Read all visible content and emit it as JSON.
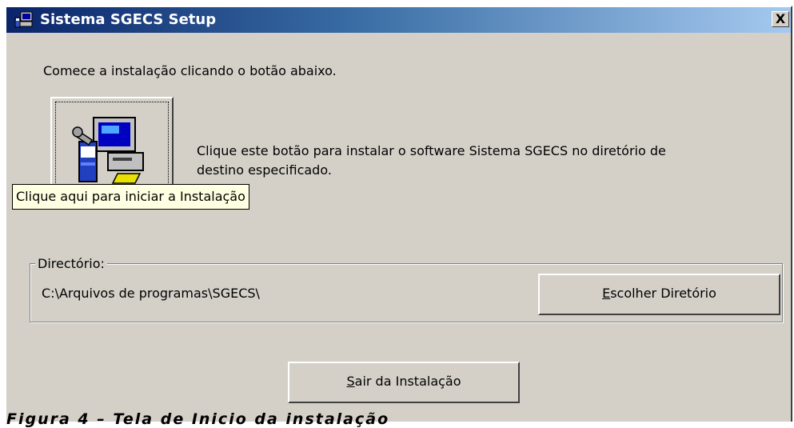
{
  "window": {
    "title": "Sistema SGECS Setup",
    "close_label": "X"
  },
  "intro_text": "Comece a instalação clicando o botão abaixo.",
  "install": {
    "description_line1": "Clique este botão para instalar o software Sistema SGECS no diretório de",
    "description_line2": "destino especificado.",
    "tooltip": "Clique aqui para iniciar a Instalação",
    "icon": "computer-setup-icon"
  },
  "directory": {
    "group_label": "Directório:",
    "path": "C:\\Arquivos de programas\\SGECS\\",
    "choose_button": {
      "accel": "E",
      "rest": "scolher Diretório"
    }
  },
  "exit_button": {
    "accel": "S",
    "rest": "air da Instalação"
  },
  "caption": "Figura 4 – Tela de Inicio da instalação",
  "colors": {
    "face": "#d4d0c8",
    "title_start": "#0a246a",
    "title_end": "#a6caf0",
    "tooltip_bg": "#ffffe1"
  }
}
